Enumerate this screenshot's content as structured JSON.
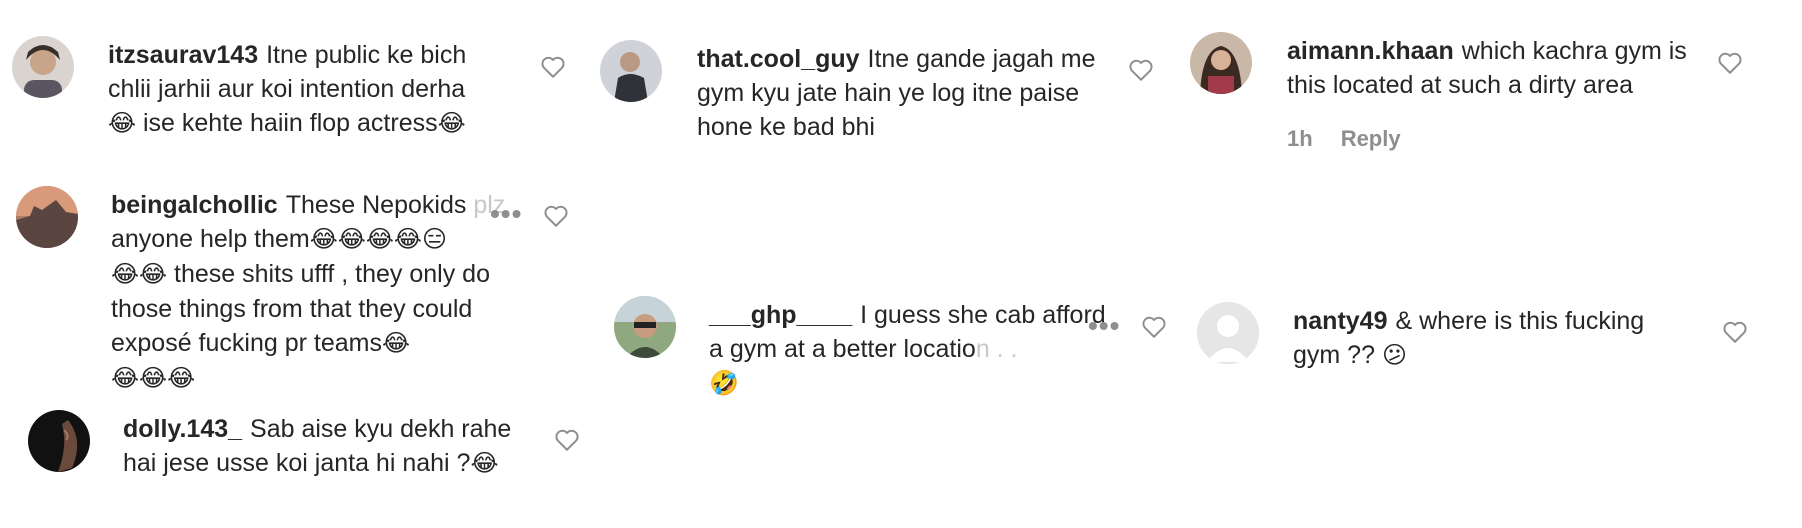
{
  "comments": [
    {
      "username": "itzsaurav143",
      "text": "Itne public ke bich chlii jarhii aur koi intention derha",
      "text2": "ise kehte haiin flop actress",
      "emoji_a": "😂",
      "emoji_b": "😂"
    },
    {
      "username": "that.cool_guy",
      "text": "Itne gande jagah me gym kyu jate hain ye log itne paise hone ke bad bhi"
    },
    {
      "username": "aimann.khaan",
      "text": "which kachra gym is this located at such a dirty area",
      "time": "1h",
      "reply_label": "Reply"
    },
    {
      "username": "beingalchollic",
      "text": "These Nepokids",
      "text_faded": "plz",
      "text2": "anyone help them",
      "emojis1": "😂😂😂😂😑",
      "emojis2": "😂😂",
      "text3": "these shits ufff , they only do those things from that they could exposé fucking pr teams",
      "emoji3": "😂",
      "emojis4": "😂😂😂"
    },
    {
      "username": "___ghp____",
      "text": "I guess she cab afford a gym at a better locatio",
      "text_faded": "n . .",
      "emoji": "🤣"
    },
    {
      "username": "nanty49",
      "text": "& where is this fucking gym ??",
      "emoji": "😕"
    },
    {
      "username": "dolly.143_",
      "text": "Sab aise kyu dekh rahe hai jese usse koi janta hi nahi ?",
      "emoji": "😂"
    }
  ],
  "icons": {
    "like": "heart-outline-icon",
    "more": "more-options-icon"
  },
  "colors": {
    "text": "#262626",
    "muted": "#8e8e8e",
    "faded": "#c8c8c8"
  }
}
